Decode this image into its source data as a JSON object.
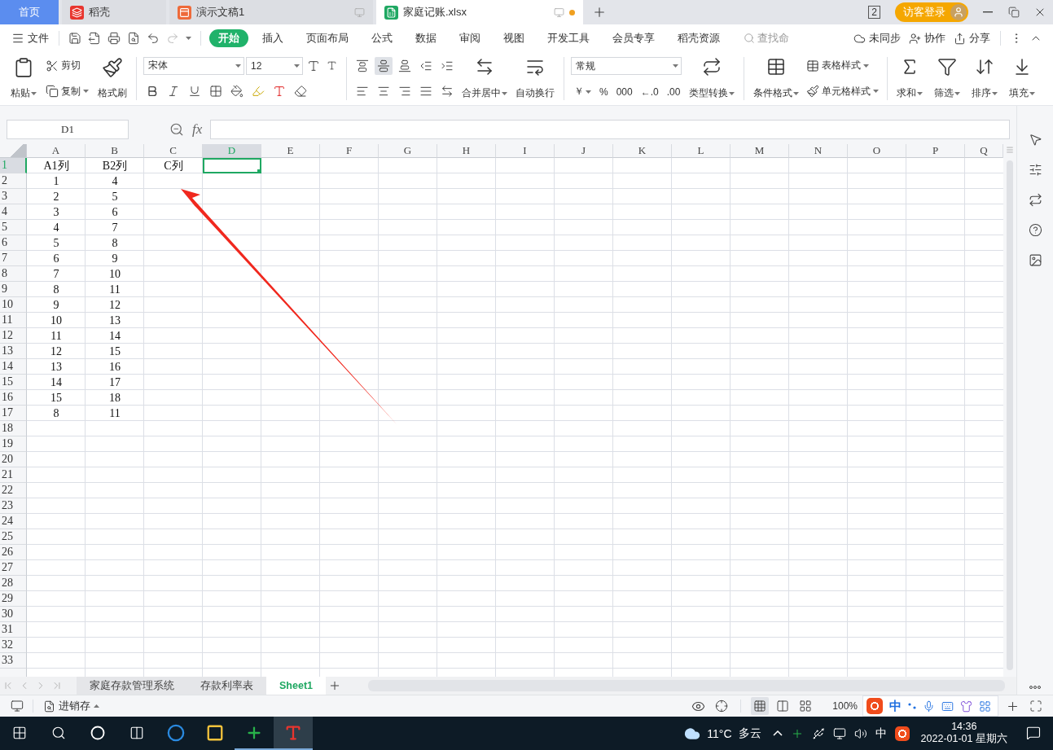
{
  "window_tabs": [
    {
      "label": "首页",
      "kind": "home",
      "selected": false,
      "unsaved": false
    },
    {
      "label": "稻壳",
      "kind": "docer",
      "selected": false,
      "unsaved": false
    },
    {
      "label": "演示文稿1",
      "kind": "slides",
      "selected": false,
      "unsaved": false
    },
    {
      "label": "家庭记账.xlsx",
      "kind": "sheet",
      "selected": true,
      "unsaved": true
    }
  ],
  "window_count": "2",
  "account": {
    "label": "访客登录"
  },
  "menu": {
    "file": "文件",
    "tabs": [
      {
        "label": "开始",
        "selected": true
      },
      {
        "label": "插入",
        "selected": false
      },
      {
        "label": "页面布局",
        "selected": false
      },
      {
        "label": "公式",
        "selected": false
      },
      {
        "label": "数据",
        "selected": false
      },
      {
        "label": "审阅",
        "selected": false
      },
      {
        "label": "视图",
        "selected": false
      },
      {
        "label": "开发工具",
        "selected": false
      },
      {
        "label": "会员专享",
        "selected": false
      },
      {
        "label": "稻壳资源",
        "selected": false
      }
    ],
    "search": {
      "placeholder": "查找命"
    },
    "actions": [
      {
        "label": "未同步",
        "kind": "sync"
      },
      {
        "label": "协作",
        "kind": "collab"
      },
      {
        "label": "分享",
        "kind": "share"
      }
    ]
  },
  "ribbon": {
    "paste": "粘贴",
    "cut": "剪切",
    "copy": "复制",
    "format_painter": "格式刷",
    "font": "宋体",
    "font_size": "12",
    "merge_center": "合并居中",
    "wrap_text": "自动换行",
    "number_format": "常规",
    "number_buttons": [
      {
        "text": "￥",
        "caret": true
      },
      {
        "text": "%",
        "caret": false
      },
      {
        "text": "000",
        "caret": false
      },
      {
        "text": "←.0",
        "caret": false
      },
      {
        "text": ".00",
        "caret": false
      }
    ],
    "align_buttons": [
      {
        "kind": "top",
        "selected": false
      },
      {
        "kind": "middle",
        "selected": true
      },
      {
        "kind": "bottom",
        "selected": false
      },
      {
        "kind": "outdent",
        "selected": false
      },
      {
        "kind": "indent",
        "selected": false
      },
      {
        "kind": "left",
        "selected": false
      },
      {
        "kind": "center",
        "selected": false
      },
      {
        "kind": "right",
        "selected": false
      },
      {
        "kind": "justify",
        "selected": false
      },
      {
        "kind": "distributed",
        "selected": false
      }
    ],
    "convert": "类型转换",
    "conditional_format": "条件格式",
    "table_style": "表格样式",
    "cell_style": "单元格样式",
    "sum": "求和",
    "filter": "筛选",
    "sort": "排序",
    "fill": "填充"
  },
  "formula_bar": {
    "name_box": "D1",
    "fx": "fx"
  },
  "grid": {
    "columns": [
      {
        "label": "A",
        "selected": false
      },
      {
        "label": "B",
        "selected": false
      },
      {
        "label": "C",
        "selected": false
      },
      {
        "label": "D",
        "selected": true
      },
      {
        "label": "E",
        "selected": false
      },
      {
        "label": "F",
        "selected": false
      },
      {
        "label": "G",
        "selected": false
      },
      {
        "label": "H",
        "selected": false
      },
      {
        "label": "I",
        "selected": false
      },
      {
        "label": "J",
        "selected": false
      },
      {
        "label": "K",
        "selected": false
      },
      {
        "label": "L",
        "selected": false
      },
      {
        "label": "M",
        "selected": false
      },
      {
        "label": "N",
        "selected": false
      },
      {
        "label": "O",
        "selected": false
      },
      {
        "label": "P",
        "selected": false
      },
      {
        "label": "Q",
        "selected": false
      }
    ],
    "rows": [
      {
        "label": "1",
        "selected": true,
        "cells": [
          "A1列",
          "B2列",
          "C列"
        ]
      },
      {
        "label": "2",
        "selected": false,
        "cells": [
          "1",
          "4"
        ]
      },
      {
        "label": "3",
        "selected": false,
        "cells": [
          "2",
          "5"
        ]
      },
      {
        "label": "4",
        "selected": false,
        "cells": [
          "3",
          "6"
        ]
      },
      {
        "label": "5",
        "selected": false,
        "cells": [
          "4",
          "7"
        ]
      },
      {
        "label": "6",
        "selected": false,
        "cells": [
          "5",
          "8"
        ]
      },
      {
        "label": "7",
        "selected": false,
        "cells": [
          "6",
          "9"
        ]
      },
      {
        "label": "8",
        "selected": false,
        "cells": [
          "7",
          "10"
        ]
      },
      {
        "label": "9",
        "selected": false,
        "cells": [
          "8",
          "11"
        ]
      },
      {
        "label": "10",
        "selected": false,
        "cells": [
          "9",
          "12"
        ]
      },
      {
        "label": "11",
        "selected": false,
        "cells": [
          "10",
          "13"
        ]
      },
      {
        "label": "12",
        "selected": false,
        "cells": [
          "11",
          "14"
        ]
      },
      {
        "label": "13",
        "selected": false,
        "cells": [
          "12",
          "15"
        ]
      },
      {
        "label": "14",
        "selected": false,
        "cells": [
          "13",
          "16"
        ]
      },
      {
        "label": "15",
        "selected": false,
        "cells": [
          "14",
          "17"
        ]
      },
      {
        "label": "16",
        "selected": false,
        "cells": [
          "15",
          "18"
        ]
      },
      {
        "label": "17",
        "selected": false,
        "cells": [
          "8",
          "11"
        ]
      },
      {
        "label": "18",
        "selected": false,
        "cells": []
      },
      {
        "label": "19",
        "selected": false,
        "cells": []
      },
      {
        "label": "20",
        "selected": false,
        "cells": []
      },
      {
        "label": "21",
        "selected": false,
        "cells": []
      },
      {
        "label": "22",
        "selected": false,
        "cells": []
      },
      {
        "label": "23",
        "selected": false,
        "cells": []
      },
      {
        "label": "24",
        "selected": false,
        "cells": []
      },
      {
        "label": "25",
        "selected": false,
        "cells": []
      },
      {
        "label": "26",
        "selected": false,
        "cells": []
      },
      {
        "label": "27",
        "selected": false,
        "cells": []
      },
      {
        "label": "28",
        "selected": false,
        "cells": []
      },
      {
        "label": "29",
        "selected": false,
        "cells": []
      },
      {
        "label": "30",
        "selected": false,
        "cells": []
      },
      {
        "label": "31",
        "selected": false,
        "cells": []
      },
      {
        "label": "32",
        "selected": false,
        "cells": []
      },
      {
        "label": "33",
        "selected": false,
        "cells": []
      }
    ]
  },
  "sheet_tabs": [
    {
      "label": "家庭存款管理系统",
      "selected": false
    },
    {
      "label": "存款利率表",
      "selected": false
    },
    {
      "label": "Sheet1",
      "selected": true
    }
  ],
  "status_bar": {
    "macro_label": "进销存",
    "zoom": "100%",
    "views": [
      {
        "kind": "normal",
        "selected": true
      },
      {
        "kind": "layout",
        "selected": false
      },
      {
        "kind": "break",
        "selected": false
      }
    ]
  },
  "ime_bar": {
    "mode": "中"
  },
  "taskbar": {
    "apps": [
      {
        "kind": "ie",
        "running": false,
        "selected": false
      },
      {
        "kind": "explorer",
        "running": false,
        "selected": false
      },
      {
        "kind": "guard",
        "running": true,
        "selected": false
      },
      {
        "kind": "wps",
        "running": true,
        "selected": true
      }
    ],
    "weather": {
      "temp": "11°C",
      "text": "多云"
    },
    "ime": "中",
    "time": "14:36",
    "date": "2022-01-01 星期六"
  }
}
